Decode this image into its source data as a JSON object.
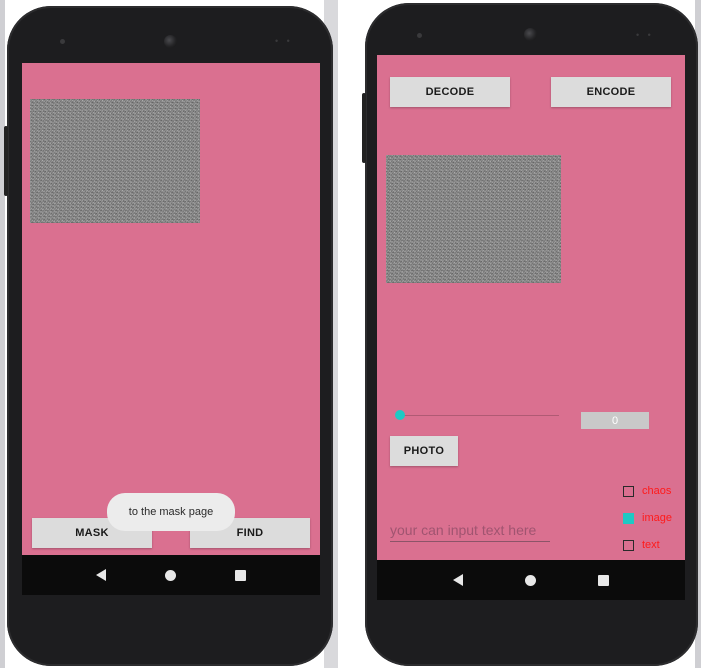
{
  "left_screen": {
    "buttons": {
      "mask": "MASK",
      "find": "FIND"
    },
    "toast": "to the mask page"
  },
  "right_screen": {
    "buttons": {
      "decode": "DECODE",
      "encode": "ENCODE",
      "photo": "PHOTO"
    },
    "seekbar": {
      "value": 0,
      "value_label": "0"
    },
    "text_input": {
      "placeholder": "your can input text here"
    },
    "checkboxes": [
      {
        "label": "chaos",
        "checked": false
      },
      {
        "label": "image",
        "checked": true
      },
      {
        "label": "text",
        "checked": false
      }
    ]
  },
  "colors": {
    "screen_background": "#da7090",
    "accent": "#1ec9c4",
    "checkbox_label": "#ff1a1a",
    "button_background": "#dcdcdc"
  },
  "icons": {
    "nav": [
      "back-triangle-icon",
      "home-circle-icon",
      "recent-square-icon"
    ]
  }
}
